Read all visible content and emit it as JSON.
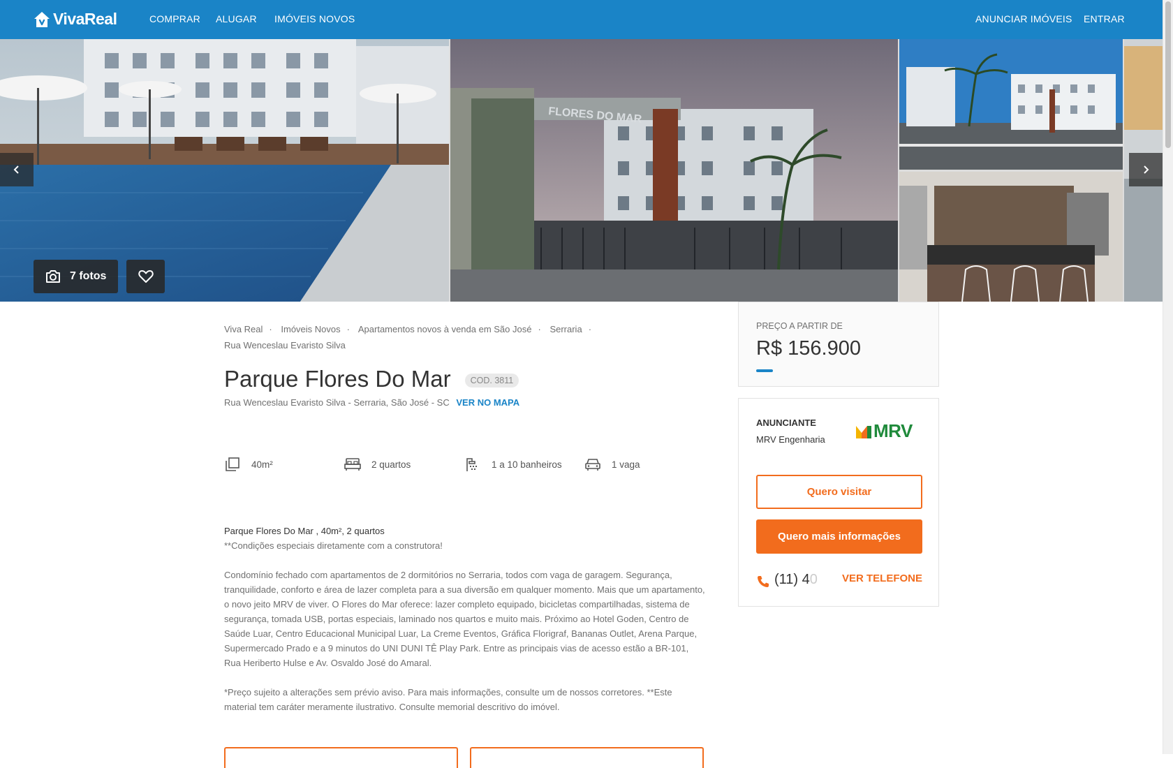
{
  "brand": {
    "name": "VivaReal",
    "primary_color": "#1a84c7",
    "accent_color": "#f26c1d"
  },
  "nav": {
    "left": [
      {
        "label": "COMPRAR"
      },
      {
        "label": "ALUGAR"
      },
      {
        "label": "IMÓVEIS NOVOS"
      }
    ],
    "right": [
      {
        "label": "ANUNCIAR IMÓVEIS"
      },
      {
        "label": "ENTRAR"
      }
    ]
  },
  "gallery": {
    "photos_label": "7 fotos",
    "entrance_sign": "FLORES DO MAR",
    "icons": {
      "prev": "chevron-left-icon",
      "next": "chevron-right-icon",
      "camera": "camera-icon",
      "favorite": "heart-icon"
    }
  },
  "breadcrumbs": [
    "Viva Real",
    "Imóveis Novos",
    "Apartamentos novos à venda em São José",
    "Serraria",
    "Rua Wenceslau Evaristo Silva"
  ],
  "listing": {
    "title": "Parque Flores Do Mar",
    "code": "COD. 3811",
    "address": "Rua Wenceslau Evaristo Silva - Serraria, São José - SC",
    "map_link": "VER NO MAPA",
    "features": [
      {
        "icon": "area-icon",
        "label": "40m²"
      },
      {
        "icon": "bed-icon",
        "label": "2 quartos"
      },
      {
        "icon": "shower-icon",
        "label": "1 a 10 banheiros"
      },
      {
        "icon": "car-icon",
        "label": "1 vaga"
      }
    ],
    "description": {
      "headline": "Parque Flores Do Mar , 40m², 2 quartos",
      "subline": "**Condições especiais diretamente com a construtora!",
      "body": "Condomínio fechado com apartamentos de 2 dormitórios no Serraria, todos com vaga de garagem. Segurança, tranquilidade, conforto e área de lazer completa para a sua diversão em qualquer momento. Mais que um apartamento, o novo jeito MRV de viver. O Flores do Mar oferece: lazer completo equipado, bicicletas compartilhadas, sistema de segurança, tomada USB, portas especiais, laminado nos quartos e muito mais. Próximo ao Hotel Goden, Centro de Saúde Luar, Centro Educacional Municipal Luar, La Creme Eventos, Gráfica Florigraf, Bananas Outlet, Arena Parque, Supermercado Prado e a 9 minutos do UNI DUNI TÊ Play Park. Entre as principais vias de acesso estão a BR-101, Rua Heriberto Hulse e Av. Osvaldo José do Amaral.",
      "disclaimer": "*Preço sujeito a alterações sem prévio aviso. Para mais informações, consulte um de nossos corretores. **Este material tem caráter meramente ilustrativo. Consulte memorial descritivo do imóvel."
    }
  },
  "price": {
    "label": "PREÇO A PARTIR DE",
    "value": "R$ 156.900"
  },
  "advertiser": {
    "label": "ANUNCIANTE",
    "name": "MRV Engenharia",
    "logo_text": "MRV",
    "visit_button": "Quero visitar",
    "info_button": "Quero mais informações",
    "phone_visible": "(11) 4",
    "phone_faded": "0",
    "see_phone": "VER TELEFONE"
  }
}
